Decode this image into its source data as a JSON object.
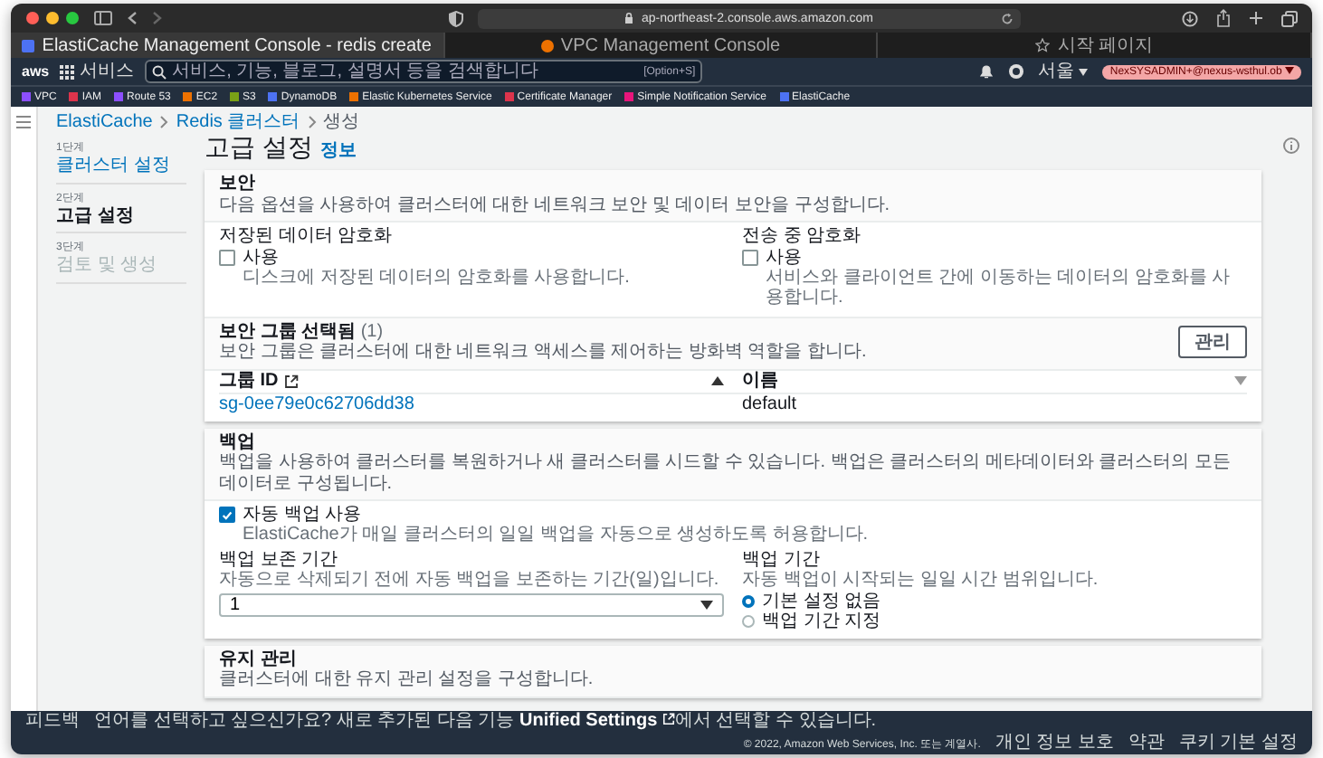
{
  "browser": {
    "url": "ap-northeast-2.console.aws.amazon.com",
    "tabs": [
      {
        "title": "ElastiCache Management Console - redis create",
        "selected": true,
        "kind": "page"
      },
      {
        "title": "VPC Management Console",
        "selected": false,
        "kind": "page"
      },
      {
        "title": "시작 페이지",
        "selected": false,
        "kind": "start"
      }
    ]
  },
  "nav": {
    "logo": "aws",
    "services": "서비스",
    "search_placeholder": "서비스, 기능, 블로그, 설명서 등을 검색합니다",
    "shortcut": "[Option+S]",
    "region": "서울",
    "account": "NexSYSADMIN+@nexus-wsthul.ob"
  },
  "bookmarks": [
    {
      "label": "VPC",
      "color": "#8c4fff"
    },
    {
      "label": "IAM",
      "color": "#dd344c"
    },
    {
      "label": "Route 53",
      "color": "#8c4fff"
    },
    {
      "label": "EC2",
      "color": "#ed7100"
    },
    {
      "label": "S3",
      "color": "#7aa116"
    },
    {
      "label": "DynamoDB",
      "color": "#4d72f3"
    },
    {
      "label": "Elastic Kubernetes Service",
      "color": "#ed7100"
    },
    {
      "label": "Certificate Manager",
      "color": "#dd344c"
    },
    {
      "label": "Simple Notification Service",
      "color": "#e7157b"
    },
    {
      "label": "ElastiCache",
      "color": "#4d72f3"
    }
  ],
  "breadcrumb": [
    "ElastiCache",
    "Redis 클러스터",
    "생성"
  ],
  "steps": [
    {
      "step": "1단계",
      "label": "클러스터 설정",
      "selected": false,
      "disabled": false
    },
    {
      "step": "2단계",
      "label": "고급 설정",
      "selected": true,
      "disabled": false
    },
    {
      "step": "3단계",
      "label": "검토 및 생성",
      "selected": false,
      "disabled": true
    }
  ],
  "title": "고급 설정",
  "info_link": "정보",
  "security": {
    "heading": "보안",
    "description": "다음 옵션을 사용하여 클러스터에 대한 네트워크 보안 및 데이터 보안을 구성합니다.",
    "options": [
      {
        "label": "저장된 데이터 암호화",
        "checkbox": "사용",
        "checked": false,
        "hint": "디스크에 저장된 데이터의 암호화를 사용합니다."
      },
      {
        "label": "전송 중 암호화",
        "checkbox": "사용",
        "checked": false,
        "hint": "서비스와 클라이언트 간에 이동하는 데이터의 암호화를 사용합니다."
      }
    ]
  },
  "security_groups": {
    "heading": "보안 그룹 선택됨",
    "count": "(1)",
    "description": "보안 그룹은 클러스터에 대한 네트워크 액세스를 제어하는 방화벽 역할을 합니다.",
    "manage_button": "관리",
    "columns": [
      {
        "label": "그룹 ID",
        "sorted": true
      },
      {
        "label": "이름",
        "sorted": false
      }
    ],
    "rows": [
      [
        "sg-0ee79e0c62706dd38",
        "default"
      ]
    ]
  },
  "backup": {
    "heading": "백업",
    "description": "백업을 사용하여 클러스터를 복원하거나 새 클러스터를 시드할 수 있습니다. 백업은 클러스터의 메타데이터와 클러스터의 모든 데이터로 구성됩니다.",
    "auto": {
      "label": "자동 백업 사용",
      "checked": true,
      "hint": "ElastiCache가 매일 클러스터의 일일 백업을 자동으로 생성하도록 허용합니다."
    },
    "retention": {
      "label": "백업 보존 기간",
      "hint": "자동으로 삭제되기 전에 자동 백업을 보존하는 기간(일)입니다.",
      "value": "1"
    },
    "window": {
      "label": "백업 기간",
      "hint": "자동 백업이 시작되는 일일 시간 범위입니다.",
      "options": [
        {
          "label": "기본 설정 없음",
          "selected": true
        },
        {
          "label": "백업 기간 지정",
          "selected": false
        }
      ]
    }
  },
  "maintenance": {
    "heading": "유지 관리",
    "description": "클러스터에 대한 유지 관리 설정을 구성합니다."
  },
  "footer": {
    "feedback": "피드백",
    "notice": "언어를 선택하고 싶으신가요? 새로 추가된 다음 기능",
    "notice_link": "Unified Settings",
    "notice_tail": "에서 선택할 수 있습니다.",
    "copyright": "© 2022, Amazon Web Services, Inc. 또는 계열사.",
    "links": [
      "개인 정보 보호",
      "약관",
      "쿠키 기본 설정"
    ]
  }
}
